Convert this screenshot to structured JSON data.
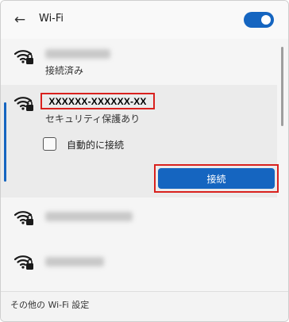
{
  "header": {
    "back_icon": "←",
    "title": "Wi-Fi",
    "toggle_state": "on"
  },
  "networks": [
    {
      "status": "接続済み"
    },
    {
      "ssid": "XXXXXX-XXXXXX-XX",
      "security": "セキュリティ保護あり",
      "auto_connect_label": "自動的に接続",
      "auto_connect_checked": false,
      "connect_label": "接続"
    },
    {},
    {}
  ],
  "footer": {
    "more_settings": "その他の Wi-Fi 設定"
  },
  "colors": {
    "accent": "#1565c0",
    "highlight_border": "#d9211e"
  }
}
